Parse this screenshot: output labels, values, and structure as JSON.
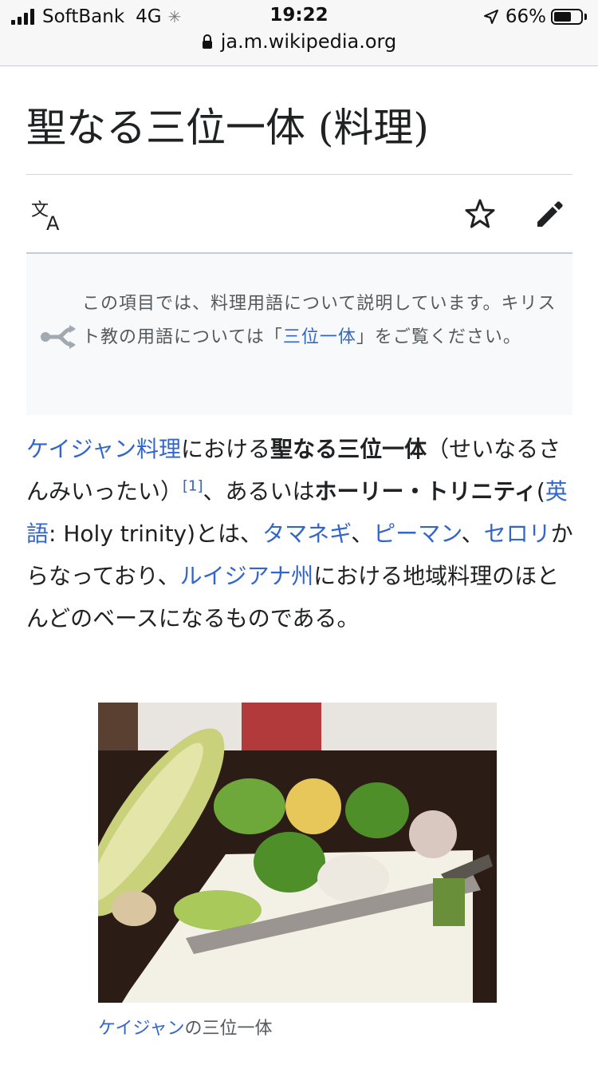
{
  "status": {
    "carrier": "SoftBank",
    "network": "4G",
    "time": "19:22",
    "battery": "66%",
    "battery_level": 0.66
  },
  "browser": {
    "url": "ja.m.wikipedia.org"
  },
  "article": {
    "title": "聖なる三位一体 (料理)",
    "hatnote": {
      "text_before": "この項目では、料理用語について説明しています。キリスト教の用語については「",
      "link": "三位一体",
      "text_after": "」をご覧ください。"
    },
    "body": {
      "link_cajun": "ケイジャン料理",
      "t1": "における",
      "bold_title": "聖なる三位一体",
      "t2": "（せいなるさんみいったい）",
      "ref": "[1]",
      "t3": "、あるいは",
      "bold_alt": "ホーリー・トリニティ",
      "t4": "(",
      "link_english": "英語",
      "t5": ": Holy trinity)とは、",
      "link_onion": "タマネギ",
      "t6": "、",
      "link_pepper": "ピーマン",
      "t7": "、",
      "link_celery": "セロリ",
      "t8": "からなっており、",
      "link_louisiana": "ルイジアナ州",
      "t9": "における地域料理のほとんどのベースになるものである。"
    },
    "figure": {
      "caption_link": "ケイジャン",
      "caption_text": "の三位一体"
    }
  },
  "icons": {
    "language": "language-icon",
    "watch": "star-icon",
    "edit": "pencil-icon",
    "disambiguation": "disambiguation-icon"
  },
  "colors": {
    "link": "#3366cc",
    "text": "#202122",
    "hatnote_bg": "#f8f9fa"
  }
}
